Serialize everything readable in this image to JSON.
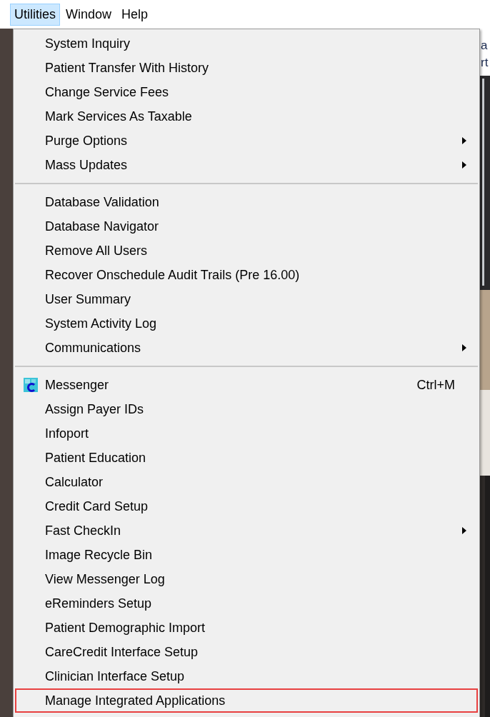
{
  "menubar": [
    {
      "label": "Utilities",
      "selected": true
    },
    {
      "label": "Window",
      "selected": false
    },
    {
      "label": "Help",
      "selected": false
    }
  ],
  "background_texts": [
    "a",
    "rt"
  ],
  "menu": {
    "sections": [
      {
        "items": [
          {
            "label": "System Inquiry",
            "submenu": false,
            "highlighted": false
          },
          {
            "label": "Patient Transfer With History",
            "submenu": false,
            "highlighted": false
          },
          {
            "label": "Change Service Fees",
            "submenu": false,
            "highlighted": false
          },
          {
            "label": "Mark Services As Taxable",
            "submenu": false,
            "highlighted": false
          },
          {
            "label": "Purge Options",
            "submenu": true,
            "highlighted": false
          },
          {
            "label": "Mass Updates",
            "submenu": true,
            "highlighted": false
          }
        ]
      },
      {
        "items": [
          {
            "label": "Database Validation",
            "submenu": false,
            "highlighted": false
          },
          {
            "label": "Database Navigator",
            "submenu": false,
            "highlighted": false
          },
          {
            "label": "Remove All Users",
            "submenu": false,
            "highlighted": false
          },
          {
            "label": "Recover Onschedule Audit Trails (Pre 16.00)",
            "submenu": false,
            "highlighted": false
          },
          {
            "label": "User Summary",
            "submenu": false,
            "highlighted": false
          },
          {
            "label": "System Activity Log",
            "submenu": false,
            "highlighted": false
          },
          {
            "label": "Communications",
            "submenu": true,
            "highlighted": false
          }
        ]
      },
      {
        "items": [
          {
            "label": "Messenger",
            "icon": true,
            "shortcut": "Ctrl+M",
            "submenu": false,
            "highlighted": false
          },
          {
            "label": "Assign Payer IDs",
            "submenu": false,
            "highlighted": false
          },
          {
            "label": "Infoport",
            "submenu": false,
            "highlighted": false
          },
          {
            "label": "Patient Education",
            "submenu": false,
            "highlighted": false
          },
          {
            "label": "Calculator",
            "submenu": false,
            "highlighted": false
          },
          {
            "label": "Credit Card Setup",
            "submenu": false,
            "highlighted": false
          },
          {
            "label": "Fast CheckIn",
            "submenu": true,
            "highlighted": false
          },
          {
            "label": "Image Recycle Bin",
            "submenu": false,
            "highlighted": false
          },
          {
            "label": "View Messenger Log",
            "submenu": false,
            "highlighted": false
          },
          {
            "label": "eReminders Setup",
            "submenu": false,
            "highlighted": false
          },
          {
            "label": "Patient Demographic Import",
            "submenu": false,
            "highlighted": false
          },
          {
            "label": "CareCredit Interface Setup",
            "submenu": false,
            "highlighted": false
          },
          {
            "label": "Clinician Interface Setup",
            "submenu": false,
            "highlighted": false
          },
          {
            "label": "Manage Integrated Applications",
            "submenu": false,
            "highlighted": true
          }
        ]
      }
    ]
  }
}
